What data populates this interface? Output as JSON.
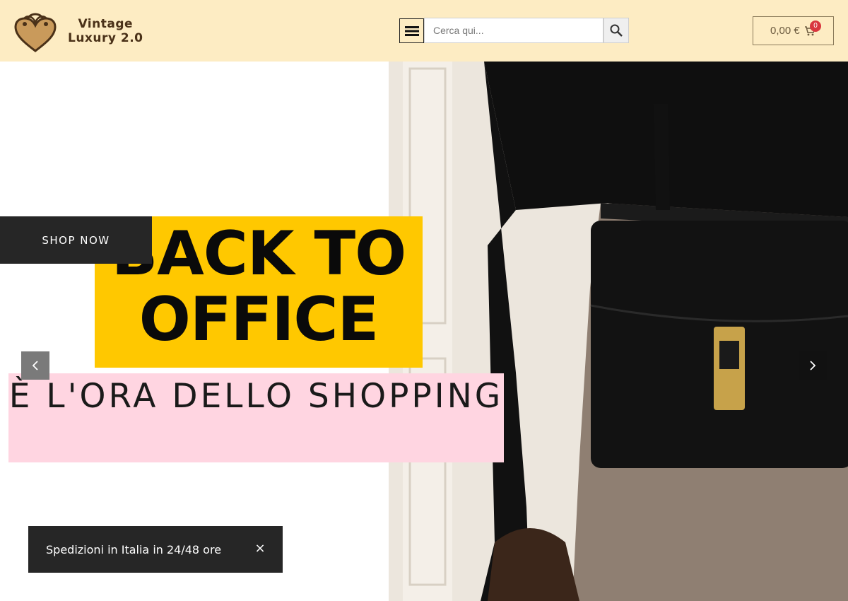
{
  "header": {
    "brand_line1": "Vintage",
    "brand_line2": "Luxury 2.0",
    "menu_icon": "hamburger-menu-icon",
    "search_placeholder": "Cerca qui...",
    "search_icon": "search-icon",
    "cart_total": "0,00 €",
    "cart_icon": "shopping-cart-icon",
    "cart_count": "0"
  },
  "hero": {
    "title_line1": "BACK TO",
    "title_line2": "OFFICE",
    "subtitle": "È L'ORA DELLO SHOPPING",
    "cta_label": "SHOP NOW",
    "prev_icon": "chevron-left-icon",
    "next_icon": "chevron-right-icon"
  },
  "notice": {
    "text": "Spedizioni in Italia in 24/48 ore",
    "close_label": "×"
  },
  "colors": {
    "header_bg": "#fdecc3",
    "yellow_accent": "#ffc800",
    "pink_accent": "#ffd5e1",
    "dark": "#262626",
    "badge": "#d9363e",
    "brand": "#4a3118"
  }
}
